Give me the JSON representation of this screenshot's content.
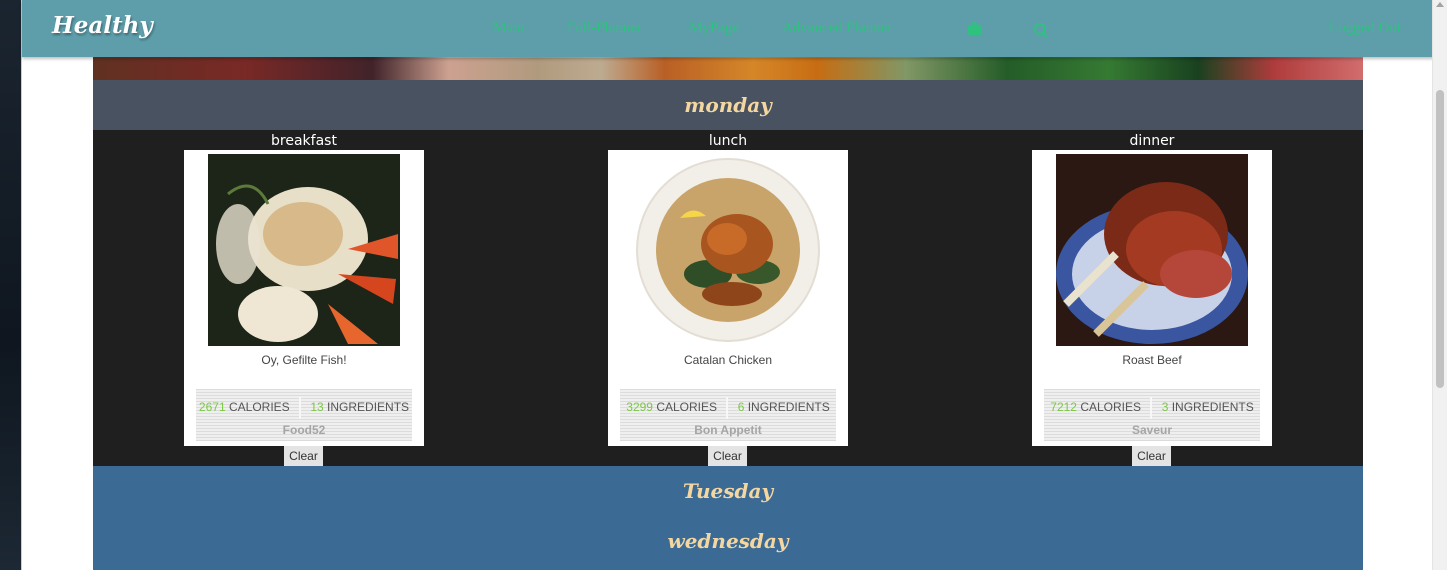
{
  "brand": "Healthy",
  "nav": {
    "links": [
      "Main",
      "Full-Planner",
      "MyPage",
      "Advanced Planner"
    ],
    "icons": [
      "calendar-icon",
      "search-icon"
    ],
    "logout": "Logged Out"
  },
  "colors": {
    "navbar": "#5e9eab",
    "nav_link": "#2ec27e",
    "monday_header": "#485261",
    "week_bg": "#3b6a94",
    "day_title": "#f4d6a0",
    "stat_number": "#7ac943"
  },
  "days": {
    "monday": "monday",
    "tuesday": "Tuesday",
    "wednesday": "wednesday"
  },
  "meals": [
    {
      "label": "breakfast",
      "title": "Oy, Gefilte Fish!",
      "calories": "2671",
      "calories_label": "CALORIES",
      "ingredients": "13",
      "ingredients_label": "INGREDIENTS",
      "source": "Food52",
      "clear": "Clear"
    },
    {
      "label": "lunch",
      "title": "Catalan Chicken",
      "calories": "3299",
      "calories_label": "CALORIES",
      "ingredients": "6",
      "ingredients_label": "INGREDIENTS",
      "source": "Bon Appetit",
      "clear": "Clear"
    },
    {
      "label": "dinner",
      "title": "Roast Beef",
      "calories": "7212",
      "calories_label": "CALORIES",
      "ingredients": "3",
      "ingredients_label": "INGREDIENTS",
      "source": "Saveur",
      "clear": "Clear"
    }
  ]
}
